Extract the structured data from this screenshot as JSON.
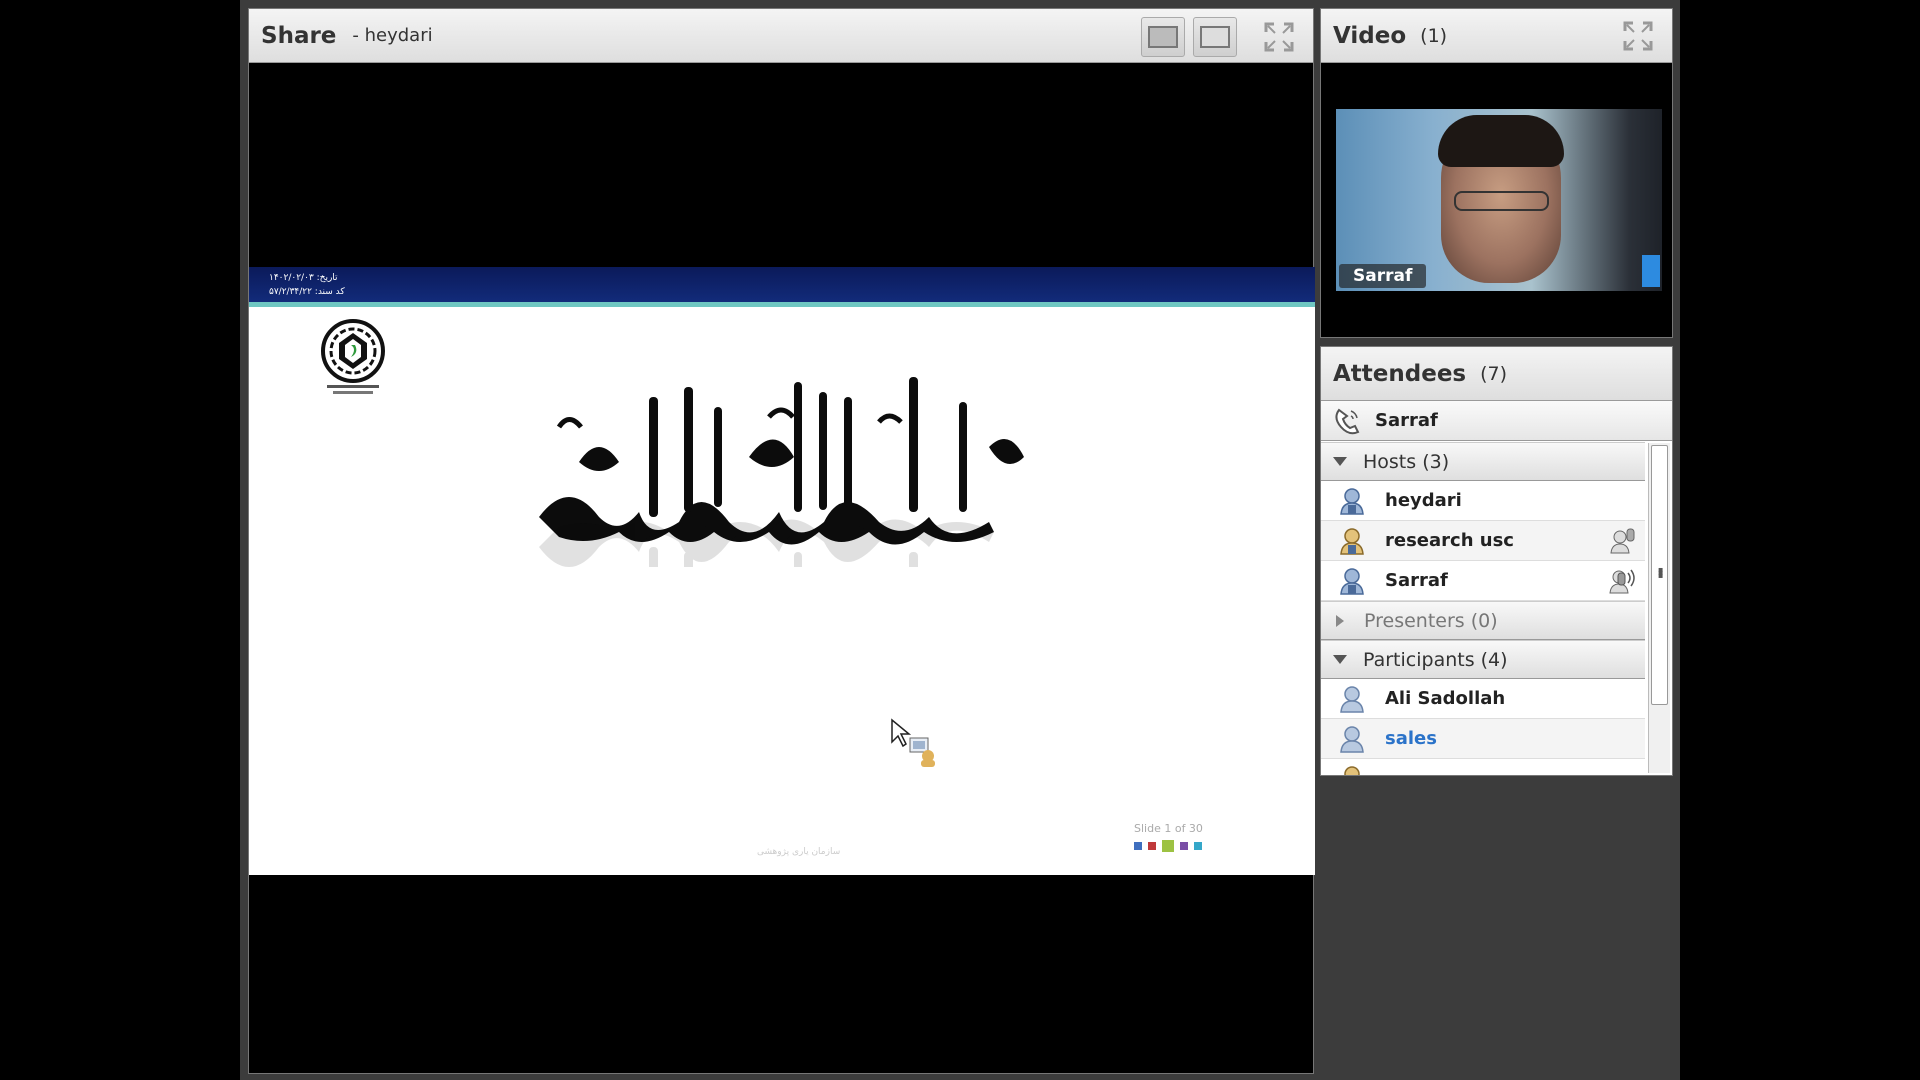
{
  "share": {
    "title": "Share",
    "presenter": "- heydari",
    "slide": {
      "date_line1": "تاریخ:   ۱۴۰۲/۰۲/۰۳",
      "date_line2": "کد سند:   ۵۷/۲/۳۴/۲۲",
      "counter": "Slide 1 of 30",
      "footer_text": "سازمان یاری پژوهشی",
      "square_colors": [
        "#3f6fbf",
        "#c0393b",
        "#9dc243",
        "#7a4ea6",
        "#35a7c9"
      ]
    }
  },
  "video": {
    "title": "Video",
    "count": "(1)",
    "feed_name": "Sarraf"
  },
  "attendees": {
    "title": "Attendees",
    "count": "(7)",
    "myself": "Sarraf",
    "groups": [
      {
        "label": "Hosts (3)",
        "expanded": true
      },
      {
        "label": "Presenters (0)",
        "expanded": false
      },
      {
        "label": "Participants (4)",
        "expanded": true
      }
    ],
    "hosts": [
      {
        "name": "heydari",
        "status": ""
      },
      {
        "name": "research usc",
        "status": "speaker-icon"
      },
      {
        "name": "Sarraf",
        "status": "microphone-icon"
      }
    ],
    "participants": [
      {
        "name": "Ali Sadollah"
      },
      {
        "name": "sales"
      }
    ]
  }
}
